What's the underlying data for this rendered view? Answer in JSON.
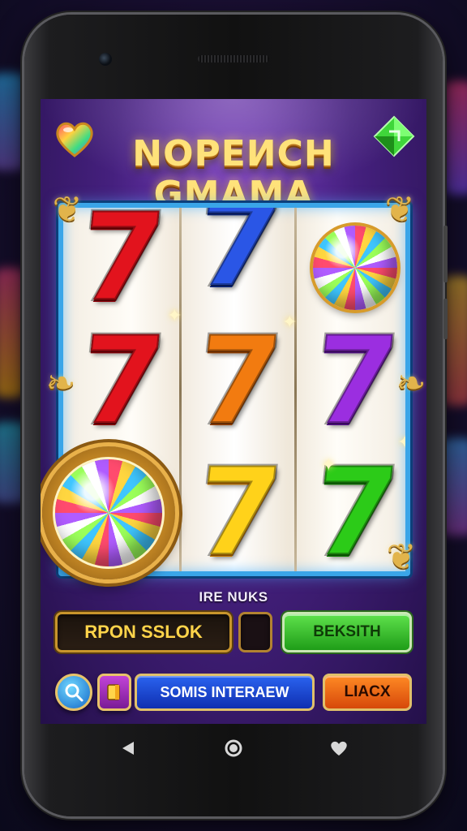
{
  "game": {
    "title_line1": "NOPEИCH",
    "title_line2": "GMAMA",
    "panel_label": "IRE NUKS"
  },
  "reels": {
    "symbols": [
      [
        "seven-red",
        "seven-red",
        "disco-ball"
      ],
      [
        "seven-blue",
        "seven-orange",
        "seven-yellow"
      ],
      [
        "disco-ball",
        "seven-purple",
        "seven-green"
      ]
    ],
    "seven_glyph": "7"
  },
  "buttons": {
    "spin_label": "RPON SSLOK",
    "blank_label": "",
    "green_label": "BEKSITH",
    "blue_label": "SOMIS INTERAEW",
    "orange_label": "LIACX"
  },
  "icons": {
    "top_left": "heart-icon",
    "top_right": "gem-icon",
    "search": "search-icon",
    "book": "book-icon",
    "nav_back": "back-triangle-icon",
    "nav_home": "home-circle-icon",
    "nav_recent": "heart-nav-icon"
  },
  "colors": {
    "accent_gold": "#ffd44a",
    "reel_frame": "#3aa5e8",
    "green_button": "#2ccb18",
    "orange_button": "#ff8a24",
    "blue_button": "#2a63f0",
    "screen_purple": "#45207e"
  }
}
